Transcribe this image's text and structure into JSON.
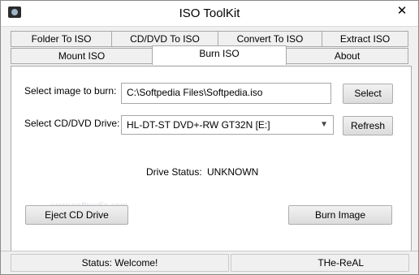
{
  "window": {
    "title": "ISO ToolKit",
    "close_glyph": "✕"
  },
  "tabs": {
    "row1": [
      "Folder To ISO",
      "CD/DVD To ISO",
      "Convert To ISO",
      "Extract ISO"
    ],
    "row2": [
      "Mount ISO",
      "Burn ISO",
      "About"
    ],
    "active": "Burn ISO"
  },
  "burn": {
    "image_label": "Select image to burn:",
    "image_path": "C:\\Softpedia Files\\Softpedia.iso",
    "select_button": "Select",
    "drive_label": "Select CD/DVD Drive:",
    "drive_value": "HL-DT-ST DVD+-RW GT32N [E:]",
    "refresh_button": "Refresh",
    "drive_status_label": "Drive Status:",
    "drive_status_value": "UNKNOWN",
    "eject_button": "Eject CD Drive",
    "burn_button": "Burn Image",
    "watermark": "www.softpedia.com"
  },
  "status": {
    "message": "Status: Welcome!",
    "author": "THe-ReAL"
  },
  "colors": {
    "window_bg": "#f0f0f0",
    "panel_bg": "#ffffff",
    "border": "#a9a9a9"
  }
}
